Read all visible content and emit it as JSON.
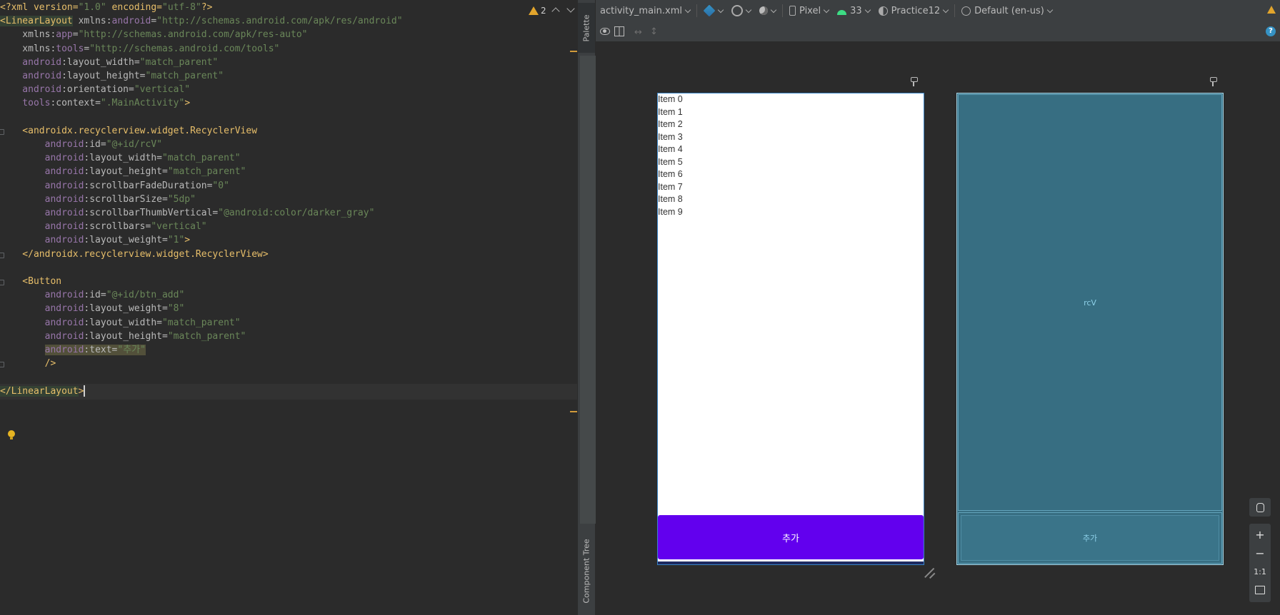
{
  "editor": {
    "warning_count": "2",
    "lines": [
      [
        [
          "t-decl",
          "<?xml version="
        ],
        [
          "t-val",
          "\"1.0\""
        ],
        [
          "t-decl",
          " encoding="
        ],
        [
          "t-val",
          "\"utf-8\""
        ],
        [
          "t-decl",
          "?>"
        ]
      ],
      [
        [
          "t-tag hl-green",
          "<LinearLayout"
        ],
        [
          "t-plain",
          " xmlns:"
        ],
        [
          "t-attr",
          "android"
        ],
        [
          "t-plain",
          "="
        ],
        [
          "t-val",
          "\"http://schemas.android.com/apk/res/android\""
        ]
      ],
      [
        [
          "t-plain",
          "    xmlns:"
        ],
        [
          "t-attr",
          "app"
        ],
        [
          "t-plain",
          "="
        ],
        [
          "t-val",
          "\"http://schemas.android.com/apk/res-auto\""
        ]
      ],
      [
        [
          "t-plain",
          "    xmlns:"
        ],
        [
          "t-attr",
          "tools"
        ],
        [
          "t-plain",
          "="
        ],
        [
          "t-val",
          "\"http://schemas.android.com/tools\""
        ]
      ],
      [
        [
          "t-attr",
          "    android"
        ],
        [
          "t-plain",
          ":layout_width="
        ],
        [
          "t-val",
          "\"match_parent\""
        ]
      ],
      [
        [
          "t-attr",
          "    android"
        ],
        [
          "t-plain",
          ":layout_height="
        ],
        [
          "t-val",
          "\"match_parent\""
        ]
      ],
      [
        [
          "t-attr",
          "    android"
        ],
        [
          "t-plain",
          ":orientation="
        ],
        [
          "t-val",
          "\"vertical\""
        ]
      ],
      [
        [
          "t-attr",
          "    tools"
        ],
        [
          "t-plain",
          ":context="
        ],
        [
          "t-val",
          "\".MainActivity\""
        ],
        [
          "t-punct",
          ">"
        ]
      ],
      [],
      [
        [
          "t-tag",
          "    <androidx.recyclerview.widget.RecyclerView"
        ]
      ],
      [
        [
          "t-attr",
          "        android"
        ],
        [
          "t-plain",
          ":id="
        ],
        [
          "t-val",
          "\"@+id/rcV\""
        ]
      ],
      [
        [
          "t-attr",
          "        android"
        ],
        [
          "t-plain",
          ":layout_width="
        ],
        [
          "t-val",
          "\"match_parent\""
        ]
      ],
      [
        [
          "t-attr",
          "        android"
        ],
        [
          "t-plain",
          ":layout_height="
        ],
        [
          "t-val",
          "\"match_parent\""
        ]
      ],
      [
        [
          "t-attr",
          "        android"
        ],
        [
          "t-plain",
          ":scrollbarFadeDuration="
        ],
        [
          "t-val",
          "\"0\""
        ]
      ],
      [
        [
          "t-attr",
          "        android"
        ],
        [
          "t-plain",
          ":scrollbarSize="
        ],
        [
          "t-val",
          "\"5dp\""
        ]
      ],
      [
        [
          "t-attr",
          "        android"
        ],
        [
          "t-plain",
          ":scrollbarThumbVertical="
        ],
        [
          "t-val",
          "\"@android:color/darker_gray\""
        ]
      ],
      [
        [
          "t-attr",
          "        android"
        ],
        [
          "t-plain",
          ":scrollbars="
        ],
        [
          "t-val",
          "\"vertical\""
        ]
      ],
      [
        [
          "t-attr",
          "        android"
        ],
        [
          "t-plain",
          ":layout_weight="
        ],
        [
          "t-val",
          "\"1\""
        ],
        [
          "t-punct",
          ">"
        ]
      ],
      [
        [
          "t-tag",
          "    </androidx.recyclerview.widget.RecyclerView>"
        ]
      ],
      [],
      [
        [
          "t-tag",
          "    <Button"
        ]
      ],
      [
        [
          "t-attr",
          "        android"
        ],
        [
          "t-plain",
          ":id="
        ],
        [
          "t-val",
          "\"@+id/btn_add\""
        ]
      ],
      [
        [
          "t-attr",
          "        android"
        ],
        [
          "t-plain",
          ":layout_weight="
        ],
        [
          "t-val",
          "\"8\""
        ]
      ],
      [
        [
          "t-attr",
          "        android"
        ],
        [
          "t-plain",
          ":layout_width="
        ],
        [
          "t-val",
          "\"match_parent\""
        ]
      ],
      [
        [
          "t-attr",
          "        android"
        ],
        [
          "t-plain",
          ":layout_height="
        ],
        [
          "t-val",
          "\"match_parent\""
        ]
      ],
      [
        [
          "t-plain",
          "        "
        ],
        [
          "t-attr hl-yellow",
          "android"
        ],
        [
          "t-plain hl-yellow",
          ":text="
        ],
        [
          "t-val hl-yellow",
          "\"추가\""
        ]
      ],
      [
        [
          "t-punct",
          "        />"
        ]
      ],
      [],
      [
        [
          "t-tag hl-green",
          "</LinearLayout"
        ],
        [
          "t-tag",
          ">"
        ]
      ]
    ]
  },
  "side_tabs": {
    "palette": "Palette",
    "component_tree": "Component Tree"
  },
  "toolbar": {
    "file": "activity_main.xml",
    "device": "Pixel",
    "api": "33",
    "theme": "Practice12",
    "locale": "Default (en-us)"
  },
  "design": {
    "items": [
      "Item 0",
      "Item 1",
      "Item 2",
      "Item 3",
      "Item 4",
      "Item 5",
      "Item 6",
      "Item 7",
      "Item 8",
      "Item 9"
    ],
    "button_text": "추가",
    "button_color": "#6200ee"
  },
  "blueprint": {
    "recycler_id": "rcV",
    "button_text": "추가"
  },
  "zoom": {
    "one_to_one": "1:1",
    "plus": "+",
    "minus": "−"
  },
  "colors": {
    "editor_bg": "#2b2b2b",
    "toolbar_bg": "#3c3f41",
    "blueprint_bg": "#376e82",
    "accent": "#6200ee"
  }
}
